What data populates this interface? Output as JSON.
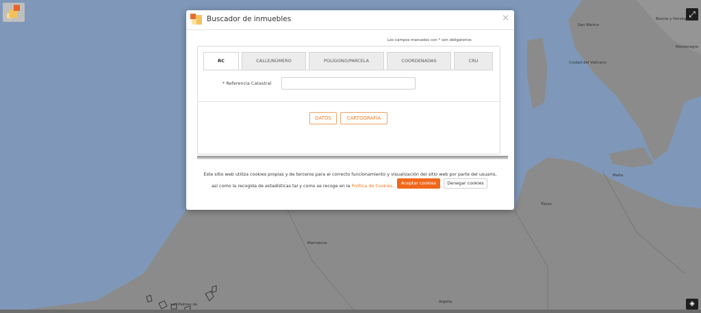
{
  "map": {
    "labels": {
      "bosnia": "Bosnia y Herzegovina",
      "san_marino": "San Marino",
      "montenegro": "Montenegro",
      "vaticano": "Ciudad del Vaticano",
      "malta": "Malta",
      "tunez": "Túnez",
      "marruecos": "Marruecos",
      "argelia": "Argelia",
      "las_palmas": "Las Palmas de"
    },
    "colors": {
      "sea": "#7f98b9",
      "land": "#8a8a8a"
    }
  },
  "controls": {
    "logo": "catastro-logo-icon",
    "expand": "expand-icon",
    "locate": "locate-icon"
  },
  "modal": {
    "title": "Buscador de inmuebles",
    "close": "×",
    "required_note": "Los campos marcados con * son obligatorios",
    "tabs": [
      {
        "label": "RC",
        "active": true
      },
      {
        "label": "CALLE/NÚMERO"
      },
      {
        "label": "POLÍGONO/PARCELA"
      },
      {
        "label": "COORDENADAS"
      },
      {
        "label": "CRU"
      }
    ],
    "field_label": "* Referencia Catastral",
    "field_value": "",
    "btn_datos": "DATOS",
    "btn_cartografia": "CARTOGRAFÍA",
    "cookies": {
      "line1": "Este sitio web utiliza cookies propias y de terceros para el correcto funcionamiento y visualización del sitio web por parte del usuario,",
      "line2_pre": "así como la recogida de estadísticas tal y como se recoge en la ",
      "link": "Política de Cookies",
      "line2_post": ".",
      "accept": "Aceptar cookies",
      "deny": "Denegar cookies"
    },
    "accent": "#ee7a22"
  }
}
